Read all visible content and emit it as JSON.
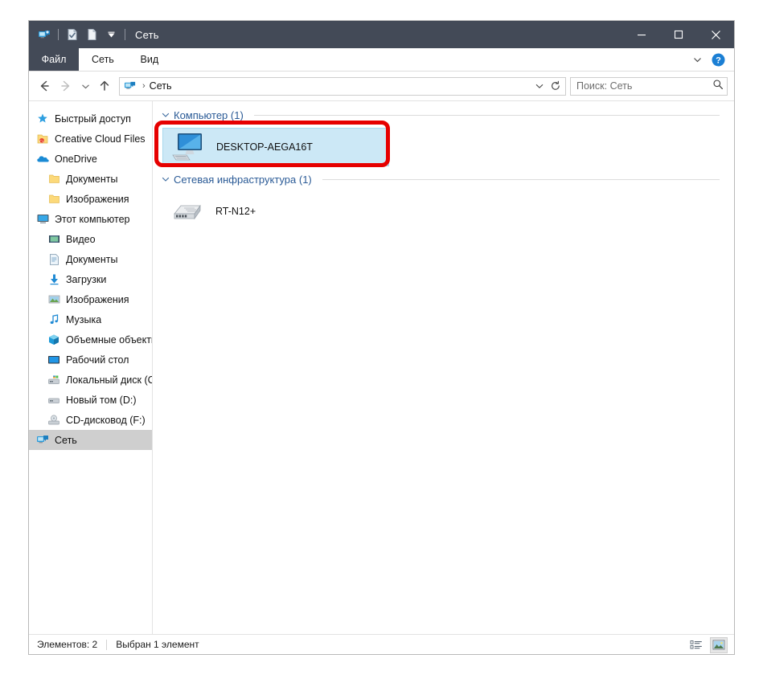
{
  "window": {
    "title": "Сеть",
    "titlebar_color": "#434a57",
    "accent_color": "#2a5a96",
    "annotation_color": "#e60000",
    "selection_color": "#cce8f6"
  },
  "quick_access": [
    {
      "name": "network-folder-icon",
      "tooltip": "Сеть"
    },
    {
      "name": "properties-icon",
      "tooltip": "Свойства"
    },
    {
      "name": "new-folder-icon",
      "tooltip": "Создать папку"
    },
    {
      "name": "customize-qat-dropdown-icon",
      "tooltip": "Настроить панель быстрого доступа"
    }
  ],
  "window_controls": {
    "minimize": "—",
    "maximize": "□",
    "close": "✕"
  },
  "ribbon": {
    "tabs": [
      {
        "label": "Файл",
        "active": false,
        "style": "file"
      },
      {
        "label": "Сеть",
        "active": false,
        "style": "normal"
      },
      {
        "label": "Вид",
        "active": false,
        "style": "normal"
      }
    ],
    "expand_icon": "chevron-down-icon",
    "help_icon": "help-icon"
  },
  "navigation": {
    "back": "back-arrow-icon",
    "forward": "forward-arrow-icon",
    "recent": "recent-locations-icon",
    "up": "up-arrow-icon",
    "address": {
      "icon": "network-icon",
      "crumbs": [
        "Сеть"
      ],
      "dropdown": "chevron-down-icon",
      "refresh": "refresh-icon"
    },
    "search": {
      "placeholder": "Поиск: Сеть",
      "value": "",
      "icon": "search-icon"
    }
  },
  "sidebar": {
    "items": [
      {
        "label": "Быстрый доступ",
        "icon": "pin-star-icon",
        "indent": 0,
        "selected": false
      },
      {
        "label": "Creative Cloud Files",
        "icon": "creative-cloud-icon",
        "indent": 0,
        "selected": false
      },
      {
        "label": "OneDrive",
        "icon": "onedrive-cloud-icon",
        "indent": 0,
        "selected": false
      },
      {
        "label": "Документы",
        "icon": "folder-icon",
        "indent": 1,
        "selected": false
      },
      {
        "label": "Изображения",
        "icon": "folder-icon",
        "indent": 1,
        "selected": false
      },
      {
        "label": "Этот компьютер",
        "icon": "this-pc-icon",
        "indent": 0,
        "selected": false
      },
      {
        "label": "Видео",
        "icon": "videos-icon",
        "indent": 1,
        "selected": false
      },
      {
        "label": "Документы",
        "icon": "documents-icon",
        "indent": 1,
        "selected": false
      },
      {
        "label": "Загрузки",
        "icon": "downloads-icon",
        "indent": 1,
        "selected": false
      },
      {
        "label": "Изображения",
        "icon": "pictures-icon",
        "indent": 1,
        "selected": false
      },
      {
        "label": "Музыка",
        "icon": "music-icon",
        "indent": 1,
        "selected": false
      },
      {
        "label": "Объемные объекты",
        "icon": "3d-objects-icon",
        "indent": 1,
        "selected": false
      },
      {
        "label": "Рабочий стол",
        "icon": "desktop-icon",
        "indent": 1,
        "selected": false
      },
      {
        "label": "Локальный диск (C:)",
        "icon": "system-drive-icon",
        "indent": 1,
        "selected": false
      },
      {
        "label": "Новый том (D:)",
        "icon": "drive-icon",
        "indent": 1,
        "selected": false
      },
      {
        "label": "CD-дисковод (F:)",
        "icon": "cd-drive-icon",
        "indent": 1,
        "selected": false
      },
      {
        "label": "Сеть",
        "icon": "network-icon",
        "indent": 0,
        "selected": true
      }
    ]
  },
  "content": {
    "groups": [
      {
        "title": "Компьютер (1)",
        "expanded": true,
        "items": [
          {
            "label": "DESKTOP-AEGA16T",
            "icon": "computer-icon",
            "selected": true,
            "annotated": true
          }
        ]
      },
      {
        "title": "Сетевая инфраструктура (1)",
        "expanded": true,
        "items": [
          {
            "label": "RT-N12+",
            "icon": "router-icon",
            "selected": false,
            "annotated": false
          }
        ]
      }
    ]
  },
  "statusbar": {
    "item_count": "Элементов: 2",
    "selection": "Выбран 1 элемент",
    "views": [
      {
        "name": "details-view-icon",
        "active": false
      },
      {
        "name": "large-icons-view-icon",
        "active": true
      }
    ]
  }
}
